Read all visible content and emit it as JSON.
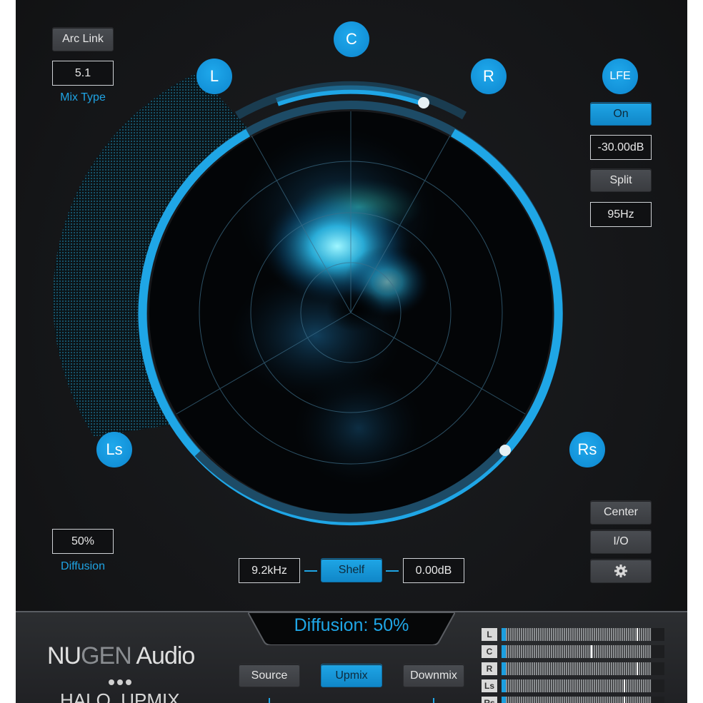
{
  "colors": {
    "accent": "#1fa6e6",
    "panel_bg": "#141517",
    "text": "#e6e6e6"
  },
  "top_left": {
    "arc_link_label": "Arc Link",
    "mix_type_value": "5.1",
    "mix_type_caption": "Mix Type"
  },
  "speakers": {
    "C": "C",
    "L": "L",
    "R": "R",
    "Ls": "Ls",
    "Rs": "Rs",
    "LFE": "LFE"
  },
  "lfe": {
    "on_label": "On",
    "gain_value": "-30.00dB",
    "split_label": "Split",
    "frequency_value": "95Hz"
  },
  "diffusion": {
    "value": "50%",
    "caption": "Diffusion",
    "readout": "Diffusion: 50%"
  },
  "shelf": {
    "frequency_value": "9.2kHz",
    "shelf_label": "Shelf",
    "gain_value": "0.00dB"
  },
  "right_buttons": {
    "center_label": "Center",
    "io_label": "I/O",
    "settings_icon": "gear-icon"
  },
  "branding": {
    "logo_nu": "NU",
    "logo_gen": "GEN",
    "logo_audio": " Audio",
    "product_name": "HALO  UPMIX"
  },
  "modes": {
    "source_label": "Source",
    "upmix_label": "Upmix",
    "downmix_label": "Downmix",
    "active": "Upmix"
  },
  "meters": [
    {
      "label": "L",
      "level": 0.92,
      "peak": 0.83
    },
    {
      "label": "C",
      "level": 0.92,
      "peak": 0.55
    },
    {
      "label": "R",
      "level": 0.92,
      "peak": 0.83
    },
    {
      "label": "Ls",
      "level": 0.92,
      "peak": 0.75
    },
    {
      "label": "Rs",
      "level": 0.92,
      "peak": 0.75
    }
  ]
}
